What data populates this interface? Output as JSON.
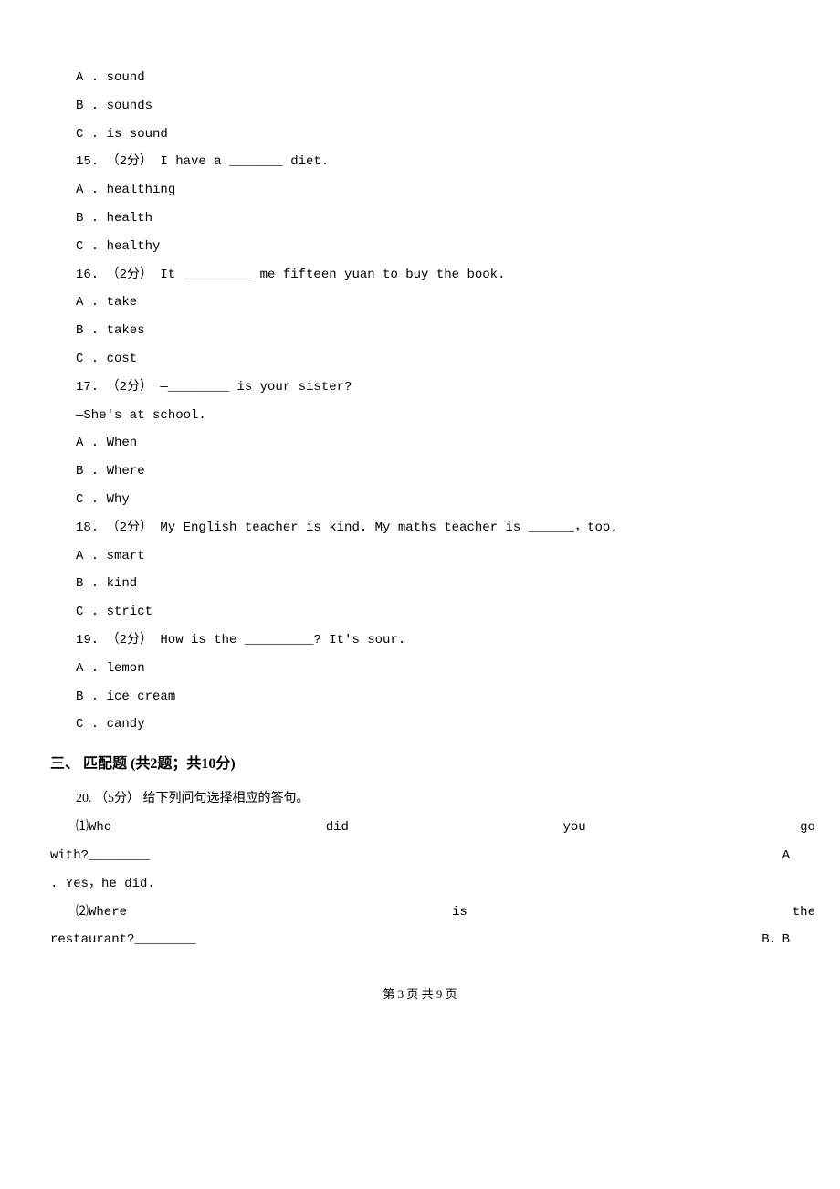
{
  "q14": {
    "optA": "A . sound",
    "optB": "B . sounds",
    "optC": "C . is sound"
  },
  "q15": {
    "prompt": "15. （2分） I have a _______ diet.",
    "optA": "A . healthing",
    "optB": "B . health",
    "optC": "C . healthy"
  },
  "q16": {
    "prompt": "16. （2分） It _________ me fifteen yuan to buy the book.",
    "optA": "A . take",
    "optB": "B . takes",
    "optC": "C . cost"
  },
  "q17": {
    "prompt": "17. （2分） —________ is your sister?",
    "sub": "—She's at school.",
    "optA": "A . When",
    "optB": "B . Where",
    "optC": "C . Why"
  },
  "q18": {
    "prompt": "18. （2分） My English teacher is kind. My maths teacher is ______，too.",
    "optA": "A . smart",
    "optB": "B . kind",
    "optC": "C . strict"
  },
  "q19": {
    "prompt": "19. （2分） How is the _________? It's sour.",
    "optA": "A . lemon",
    "optB": "B . ice cream",
    "optC": "C . candy"
  },
  "section3": {
    "heading": "三、 匹配题 (共2题；共10分)",
    "q20": {
      "prompt": "20. （5分） 给下列问句选择相应的答句。",
      "rows": {
        "r1": {
          "w1": "⑴Who",
          "w2": "did",
          "w3": "you",
          "w4": "go"
        },
        "r1b": {
          "left": "with?________",
          "right": "A"
        },
        "r1c": ". Yes，he did.",
        "r2": {
          "w1": "⑵Where",
          "w2": "is",
          "w3": "the"
        },
        "r2b": {
          "left": "restaurant?________",
          "right": "B．B"
        }
      }
    }
  },
  "footer": "第 3 页 共 9 页"
}
